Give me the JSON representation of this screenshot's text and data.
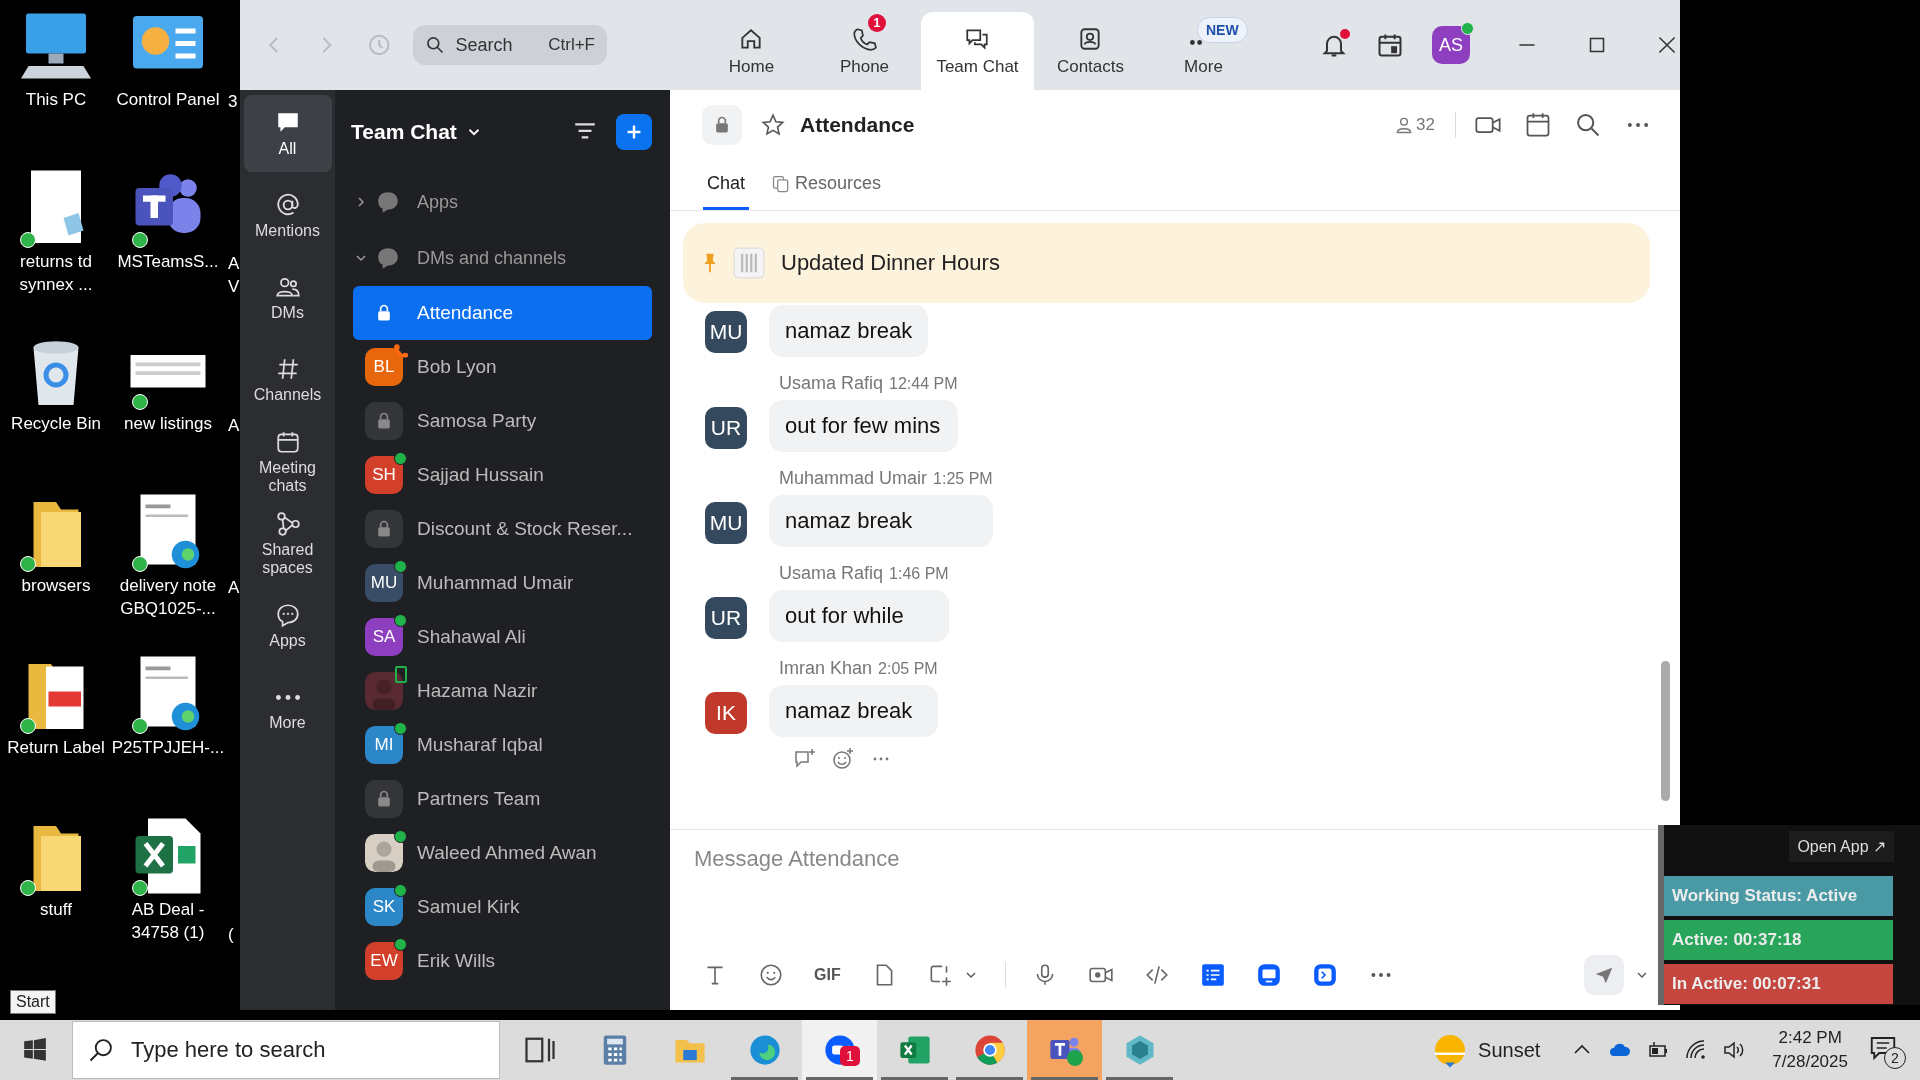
{
  "desktop": {
    "rows": [
      {
        "icons": [
          {
            "label": "This PC",
            "kind": "computer",
            "synced": false
          },
          {
            "label": "Control Panel",
            "kind": "control-panel",
            "synced": false
          }
        ],
        "cut_label": "3"
      },
      {
        "icons": [
          {
            "label": "returns td\nsynnex ...",
            "kind": "document",
            "synced": true
          },
          {
            "label": "MSTeamsS...",
            "kind": "teams",
            "synced": true
          }
        ],
        "cut_label": "A\nV"
      },
      {
        "icons": [
          {
            "label": "Recycle Bin",
            "kind": "recycle-bin",
            "synced": false
          },
          {
            "label": "new listings",
            "kind": "sheet-preview",
            "synced": true
          }
        ],
        "cut_label": "A"
      },
      {
        "icons": [
          {
            "label": "browsers",
            "kind": "folder",
            "synced": true
          },
          {
            "label": "delivery note\nGBQ1025-...",
            "kind": "edge-document",
            "synced": true
          }
        ],
        "cut_label": "A"
      },
      {
        "icons": [
          {
            "label": "Return Label",
            "kind": "pdf-folder",
            "synced": true
          },
          {
            "label": "P25TPJJEH-...",
            "kind": "edge-document",
            "synced": true
          }
        ]
      },
      {
        "icons": [
          {
            "label": "stuff",
            "kind": "folder",
            "synced": true
          },
          {
            "label": "AB Deal -\n34758 (1)",
            "kind": "excel",
            "synced": true
          }
        ],
        "cut_label": "\n("
      }
    ],
    "start_tooltip": "Start"
  },
  "window": {
    "nav": {
      "search": {
        "placeholder": "Search",
        "shortcut": "Ctrl+F"
      },
      "tabs": [
        {
          "label": "Home",
          "kind": "home",
          "selected": false
        },
        {
          "label": "Phone",
          "kind": "phone",
          "selected": false,
          "badge": {
            "text": "1",
            "kind": "count"
          }
        },
        {
          "label": "Team Chat",
          "kind": "chat",
          "selected": true
        },
        {
          "label": "Contacts",
          "kind": "contacts",
          "selected": false
        },
        {
          "label": "More",
          "kind": "more",
          "selected": false,
          "badge": {
            "text": "NEW",
            "kind": "label"
          }
        }
      ],
      "unread_alerts": true,
      "avatar": {
        "initials": "AS",
        "online": true
      }
    },
    "rail": [
      {
        "label": "All",
        "kind": "all",
        "selected": true
      },
      {
        "label": "Mentions",
        "kind": "mentions",
        "selected": false
      },
      {
        "label": "DMs",
        "kind": "dms",
        "selected": false
      },
      {
        "label": "Channels",
        "kind": "channels",
        "selected": false
      },
      {
        "label": "Meeting chats",
        "kind": "meetings",
        "selected": false
      },
      {
        "label": "Shared spaces",
        "kind": "shared",
        "selected": false
      },
      {
        "label": "Apps",
        "kind": "apps",
        "selected": false
      },
      {
        "label": "More",
        "kind": "more",
        "selected": false
      }
    ],
    "list": {
      "title": "Team Chat",
      "sections": [
        {
          "label": "Apps",
          "expanded": false
        },
        {
          "label": "DMs and channels",
          "expanded": true
        }
      ],
      "items": [
        {
          "name": "Attendance",
          "kind": "channel",
          "selected": true,
          "online": false,
          "on_call": false,
          "on_mobile": false
        },
        {
          "name": "Bob Lyon",
          "kind": "person",
          "initials": "BL",
          "color": "#e8670c",
          "selected": false,
          "online": false,
          "on_call": true,
          "on_mobile": false
        },
        {
          "name": "Samosa Party",
          "kind": "channel",
          "selected": false,
          "online": false,
          "on_call": false,
          "on_mobile": false
        },
        {
          "name": "Sajjad Hussain",
          "kind": "person",
          "initials": "SH",
          "color": "#d2402b",
          "selected": false,
          "online": true,
          "on_call": false,
          "on_mobile": false
        },
        {
          "name": "Discount & Stock Reser...",
          "kind": "channel",
          "selected": false,
          "online": false,
          "on_call": false,
          "on_mobile": false
        },
        {
          "name": "Muhammad Umair",
          "kind": "person",
          "initials": "MU",
          "color": "#3a4d66",
          "selected": false,
          "online": true,
          "on_call": false,
          "on_mobile": false
        },
        {
          "name": "Shahawal Ali",
          "kind": "person",
          "initials": "SA",
          "color": "#8e3fc0",
          "selected": false,
          "online": true,
          "on_call": false,
          "on_mobile": false
        },
        {
          "name": "Hazama Nazir",
          "color": "#5a2a33",
          "selected": false,
          "online": false,
          "on_call": false,
          "on_mobile": true
        },
        {
          "name": "Musharaf Iqbal",
          "kind": "person",
          "initials": "MI",
          "color": "#2c87c8",
          "selected": false,
          "online": true,
          "on_call": false,
          "on_mobile": false
        },
        {
          "name": "Partners Team",
          "kind": "channel",
          "selected": false,
          "online": false,
          "on_call": false,
          "on_mobile": false
        },
        {
          "name": "Waleed Ahmed Awan",
          "color": "#d8cfc4",
          "selected": false,
          "online": true,
          "on_call": false,
          "on_mobile": false
        },
        {
          "name": "Samuel Kirk",
          "kind": "person",
          "initials": "SK",
          "color": "#2c87c8",
          "selected": false,
          "online": true,
          "on_call": false,
          "on_mobile": false
        },
        {
          "name": "Erik Wills",
          "kind": "person",
          "initials": "EW",
          "color": "#d2402b",
          "selected": false,
          "online": true,
          "on_call": false,
          "on_mobile": false
        }
      ]
    },
    "chat": {
      "title": "Attendance",
      "members": "32",
      "tabs": [
        {
          "label": "Chat",
          "selected": true
        },
        {
          "label": "Resources",
          "selected": false
        }
      ],
      "pinned": "Updated Dinner Hours",
      "messages": [
        {
          "initials": "MU",
          "color": "#34495e",
          "text": "namaz break"
        },
        {
          "initials": "UR",
          "color": "#34495e",
          "sender": "Usama Rafiq",
          "time": "12:44 PM",
          "text": "out for few mins"
        },
        {
          "initials": "MU",
          "color": "#34495e",
          "sender": "Muhammad Umair",
          "time": "1:25 PM",
          "text": "namaz break"
        },
        {
          "initials": "UR",
          "color": "#34495e",
          "sender": "Usama Rafiq",
          "time": "1:46 PM",
          "text": "out for while"
        },
        {
          "initials": "IK",
          "color": "#c0392b",
          "sender": "Imran Khan",
          "time": "2:05 PM",
          "text": "namaz break"
        }
      ],
      "composer": {
        "placeholder": "Message Attendance",
        "gif_label": "GIF"
      }
    }
  },
  "widget": {
    "open_app": "Open App ↗",
    "statuses": [
      {
        "label": "Working Status: Active",
        "color": "#4a9aa5"
      },
      {
        "label": "Active: 00:37:18",
        "color": "#28a55a"
      },
      {
        "label": "In Active: 00:07:31",
        "color": "#c4463f"
      }
    ]
  },
  "taskbar": {
    "search_placeholder": "Type here to search",
    "apps": [
      {
        "kind": "task-view",
        "running": false,
        "focused": false,
        "flashing": false
      },
      {
        "kind": "calculator",
        "running": false,
        "focused": false,
        "flashing": false
      },
      {
        "kind": "file-explorer",
        "running": false,
        "focused": false,
        "flashing": false
      },
      {
        "kind": "edge",
        "running": true,
        "focused": false,
        "flashing": false
      },
      {
        "kind": "zoom",
        "running": true,
        "focused": true,
        "flashing": false,
        "badge": "1"
      },
      {
        "kind": "excel",
        "running": true,
        "focused": false,
        "flashing": false
      },
      {
        "kind": "chrome",
        "running": true,
        "focused": false,
        "flashing": false
      },
      {
        "kind": "teams",
        "running": true,
        "focused": false,
        "flashing": true
      },
      {
        "kind": "app",
        "running": true,
        "focused": false,
        "flashing": false
      }
    ],
    "weather": "Sunset",
    "time": "2:42 PM",
    "date": "7/28/2025",
    "notifications": "2"
  }
}
